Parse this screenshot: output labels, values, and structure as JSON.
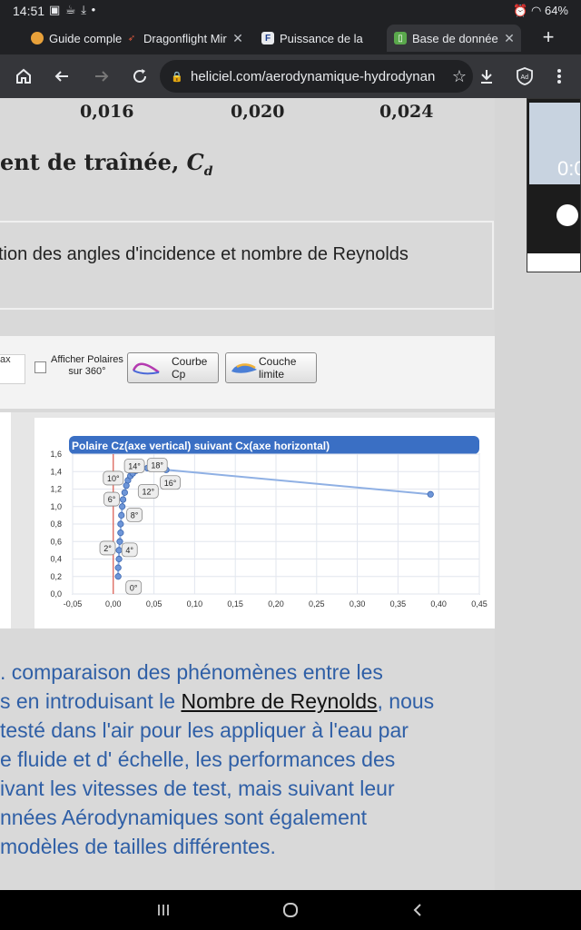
{
  "status": {
    "time": "14:51",
    "battery": "64%",
    "notif_icons": [
      "image-icon",
      "coffee-icon",
      "download-done-icon"
    ]
  },
  "tabs": [
    {
      "title": "Guide comple",
      "favicon": "orange-circle-icon",
      "active": false
    },
    {
      "title": "Dragonflight Mir",
      "favicon": "rocket-icon",
      "active": false
    },
    {
      "title": "Puissance de la",
      "favicon": "F-logo-icon",
      "active": false
    },
    {
      "title": "Base de donnée",
      "favicon": "book-icon",
      "active": true
    }
  ],
  "toolbar": {
    "url": "heliciel.com/aerodynamique-hydrodynan"
  },
  "page": {
    "top_axis_values": [
      "0,016",
      "0,020",
      "0,024"
    ],
    "traine_text": "ent de traînée, ",
    "traine_symbol": "C",
    "traine_sub": "d",
    "variation_text": "tion des angles d'incidence et nombre de Reynolds",
    "tool": {
      "ax_label": "ax",
      "polaires_label_1": "Afficher Polaires",
      "polaires_label_2": "sur 360°",
      "courbe_cp": "Courbe Cp",
      "couche_limite": "Couche limite"
    },
    "para_lines": [
      ". comparaison des phénomènes entre les",
      "s en introduisant le ",
      "testé dans l'air pour les appliquer à l'eau par",
      "e fluide et d' échelle, les performances des",
      "ivant les vitesses de test, mais suivant leur",
      "nnées Aérodynamiques sont également",
      "modèles de tailles différentes."
    ],
    "para_link": "Nombre de Reynolds",
    "para_line2_tail": ", nous"
  },
  "video": {
    "time": "0:0"
  },
  "chart_data": {
    "type": "scatter",
    "title": "Polaire Cz(axe vertical) suivant Cx(axe horizontal)",
    "xlabel": "",
    "ylabel": "",
    "xlim": [
      -0.05,
      0.45
    ],
    "ylim": [
      0.0,
      1.6
    ],
    "x_ticks": [
      "-0,05",
      "0,00",
      "0,05",
      "0,10",
      "0,15",
      "0,20",
      "0,25",
      "0,30",
      "0,35",
      "0,40",
      "0,45"
    ],
    "y_ticks": [
      "0,0",
      "0,2",
      "0,4",
      "0,6",
      "0,8",
      "1,0",
      "1,2",
      "1,4",
      "1,6"
    ],
    "grid": true,
    "series": [
      {
        "x": [
          0.006,
          0.006,
          0.007,
          0.007,
          0.008,
          0.009,
          0.009,
          0.01,
          0.011,
          0.012,
          0.014,
          0.016,
          0.018,
          0.021,
          0.024,
          0.028,
          0.034,
          0.042,
          0.05,
          0.058,
          0.065,
          0.39
        ],
        "y": [
          0.2,
          0.3,
          0.4,
          0.5,
          0.6,
          0.7,
          0.8,
          0.9,
          1.0,
          1.08,
          1.16,
          1.24,
          1.3,
          1.35,
          1.38,
          1.41,
          1.43,
          1.44,
          1.45,
          1.45,
          1.42,
          1.14
        ]
      }
    ],
    "annotations": [
      "0°",
      "2°",
      "4°",
      "6°",
      "8°",
      "10°",
      "12°",
      "14°",
      "16°",
      "18°"
    ],
    "colors": {
      "series": "#6e96d8",
      "header": "#3a6fc4",
      "zero_line": "#d83a2a"
    }
  }
}
